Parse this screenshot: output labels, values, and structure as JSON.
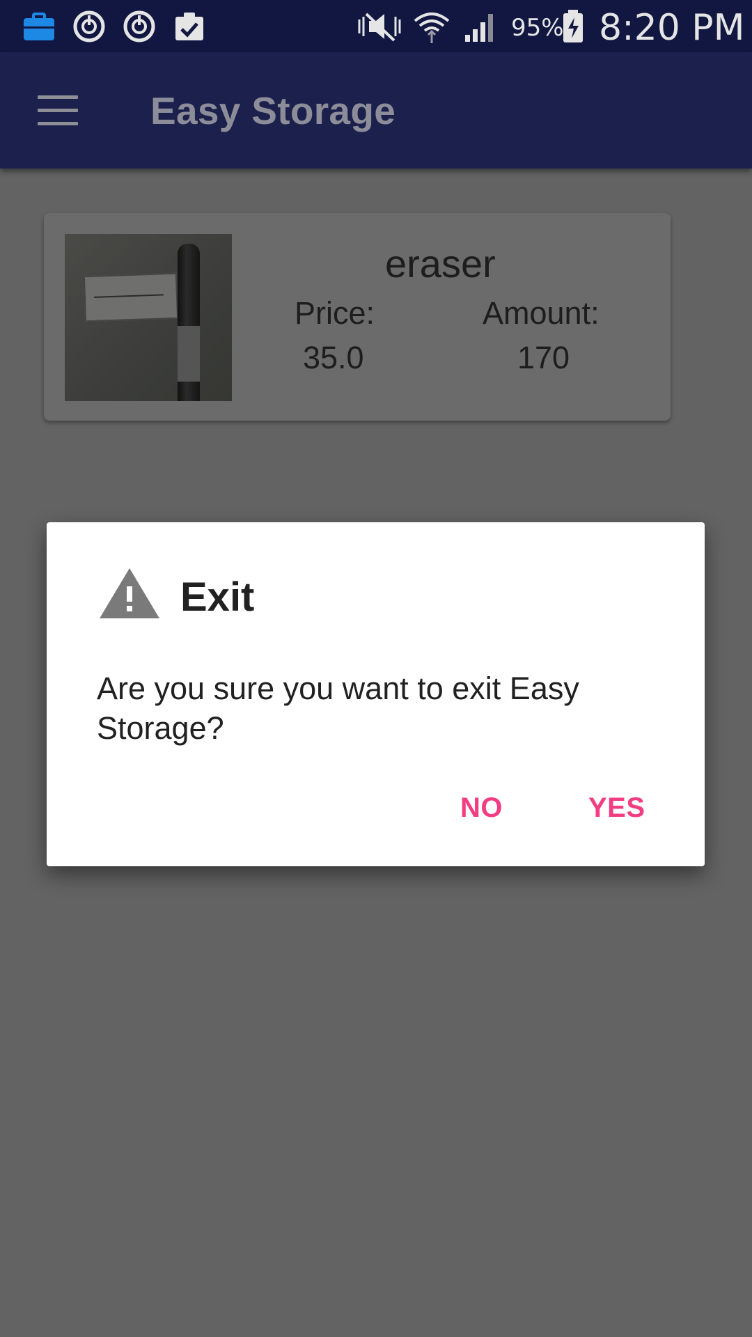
{
  "status_bar": {
    "battery": "95%",
    "time": "8:20 PM",
    "icons": [
      "briefcase-icon",
      "sync-icon",
      "sync-icon",
      "clipboard-check-icon",
      "mute-vibrate-icon",
      "wifi-icon",
      "signal-icon",
      "battery-charging-icon"
    ]
  },
  "app_bar": {
    "title": "Easy Storage"
  },
  "item": {
    "name": "eraser",
    "price_label": "Price:",
    "price": "35.0",
    "amount_label": "Amount:",
    "amount": "170"
  },
  "dialog": {
    "title": "Exit",
    "message": "Are you sure you want to exit Easy Storage?",
    "no_label": "NO",
    "yes_label": "YES"
  },
  "colors": {
    "status_bar": "#111741",
    "app_bar": "#1b204c",
    "accent": "#f23d82",
    "scrim": "#636363"
  }
}
